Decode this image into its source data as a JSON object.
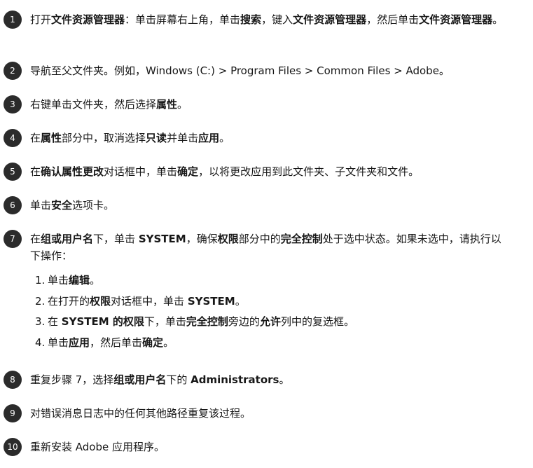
{
  "steps": [
    {
      "number": "1",
      "parts": [
        {
          "t": "打开"
        },
        {
          "t": "文件资源管理器",
          "b": true
        },
        {
          "t": "：单击屏幕右上角，单击"
        },
        {
          "t": "搜索",
          "b": true
        },
        {
          "t": "，键入"
        },
        {
          "t": "文件资源管理器",
          "b": true
        },
        {
          "t": "，然后单击"
        },
        {
          "t": "文件资源管理器",
          "b": true
        },
        {
          "t": "。"
        }
      ]
    },
    {
      "number": "2",
      "parts": [
        {
          "t": "导航至父文件夹。例如，Windows (C:) > Program Files > Common Files > Adobe。"
        }
      ]
    },
    {
      "number": "3",
      "parts": [
        {
          "t": "右键单击文件夹，然后选择"
        },
        {
          "t": "属性",
          "b": true
        },
        {
          "t": "。"
        }
      ]
    },
    {
      "number": "4",
      "parts": [
        {
          "t": "在"
        },
        {
          "t": "属性",
          "b": true
        },
        {
          "t": "部分中，取消选择"
        },
        {
          "t": "只读",
          "b": true
        },
        {
          "t": "并单击"
        },
        {
          "t": "应用",
          "b": true
        },
        {
          "t": "。"
        }
      ]
    },
    {
      "number": "5",
      "parts": [
        {
          "t": "在"
        },
        {
          "t": "确认属性更改",
          "b": true
        },
        {
          "t": "对话框中，单击"
        },
        {
          "t": "确定",
          "b": true
        },
        {
          "t": "，以将更改应用到此文件夹、子文件夹和文件。"
        }
      ]
    },
    {
      "number": "6",
      "parts": [
        {
          "t": "单击"
        },
        {
          "t": "安全",
          "b": true
        },
        {
          "t": "选项卡。"
        }
      ]
    },
    {
      "number": "7",
      "parts": [
        {
          "t": "在"
        },
        {
          "t": "组或用户名",
          "b": true
        },
        {
          "t": "下，单击 "
        },
        {
          "t": "SYSTEM",
          "b": true
        },
        {
          "t": "，确保"
        },
        {
          "t": "权限",
          "b": true
        },
        {
          "t": "部分中的"
        },
        {
          "t": "完全控制",
          "b": true
        },
        {
          "t": "处于选中状态。如果未选中，请执行以下操作："
        }
      ],
      "substeps": [
        {
          "number": "1.",
          "parts": [
            {
              "t": "单击"
            },
            {
              "t": "编辑",
              "b": true
            },
            {
              "t": "。"
            }
          ]
        },
        {
          "number": "2.",
          "parts": [
            {
              "t": "在打开的"
            },
            {
              "t": "权限",
              "b": true
            },
            {
              "t": "对话框中，单击 "
            },
            {
              "t": "SYSTEM",
              "b": true
            },
            {
              "t": "。"
            }
          ]
        },
        {
          "number": "3.",
          "parts": [
            {
              "t": "在 "
            },
            {
              "t": "SYSTEM 的权限",
              "b": true
            },
            {
              "t": "下，单击"
            },
            {
              "t": "完全控制",
              "b": true
            },
            {
              "t": "旁边的"
            },
            {
              "t": "允许",
              "b": true
            },
            {
              "t": "列中的复选框。"
            }
          ]
        },
        {
          "number": "4.",
          "parts": [
            {
              "t": "单击"
            },
            {
              "t": "应用",
              "b": true
            },
            {
              "t": "，然后单击"
            },
            {
              "t": "确定",
              "b": true
            },
            {
              "t": "。"
            }
          ]
        }
      ]
    },
    {
      "number": "8",
      "parts": [
        {
          "t": "重复步骤 7，选择"
        },
        {
          "t": "组或用户名",
          "b": true
        },
        {
          "t": "下的 "
        },
        {
          "t": "Administrators",
          "b": true
        },
        {
          "t": "。"
        }
      ]
    },
    {
      "number": "9",
      "parts": [
        {
          "t": "对错误消息日志中的任何其他路径重复该过程。"
        }
      ]
    },
    {
      "number": "10",
      "parts": [
        {
          "t": "重新安装 Adobe 应用程序。"
        }
      ]
    }
  ]
}
